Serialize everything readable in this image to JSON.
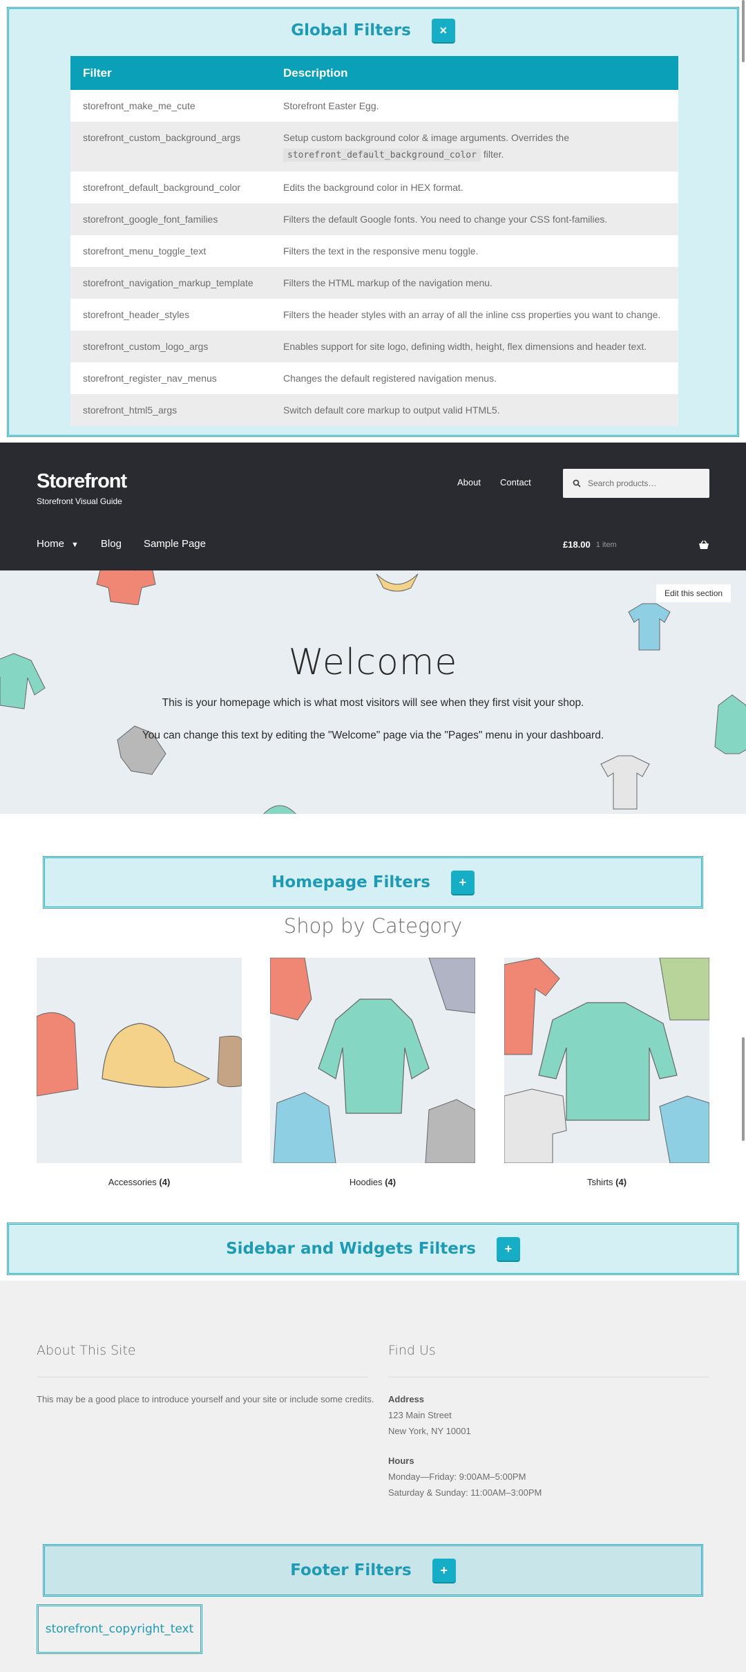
{
  "global_filters": {
    "title": "Global Filters",
    "toggle": "×",
    "headers": [
      "Filter",
      "Description"
    ],
    "rows": [
      {
        "name": "storefront_make_me_cute",
        "desc": "Storefront Easter Egg."
      },
      {
        "name": "storefront_custom_background_args",
        "desc": "Setup custom background color & image arguments. Overrides the",
        "code": "storefront_default_background_color",
        "desc_after": " filter."
      },
      {
        "name": "storefront_default_background_color",
        "desc": "Edits the background color in HEX format."
      },
      {
        "name": "storefront_google_font_families",
        "desc": "Filters the default Google fonts. You need to change your CSS font-families."
      },
      {
        "name": "storefront_menu_toggle_text",
        "desc": "Filters the text in the responsive menu toggle."
      },
      {
        "name": "storefront_navigation_markup_template",
        "desc": "Filters the HTML markup of the navigation menu."
      },
      {
        "name": "storefront_header_styles",
        "desc": "Filters the header styles with an array of all the inline css properties you want to change."
      },
      {
        "name": "storefront_custom_logo_args",
        "desc": "Enables support for site logo, defining width, height, flex dimensions and header text."
      },
      {
        "name": "storefront_register_nav_menus",
        "desc": "Changes the default registered navigation menus."
      },
      {
        "name": "storefront_html5_args",
        "desc": "Switch default core markup to output valid HTML5."
      }
    ]
  },
  "header": {
    "site_title": "Storefront",
    "site_description": "Storefront Visual Guide",
    "top_nav": [
      "About",
      "Contact"
    ],
    "search_placeholder": "Search products…",
    "main_nav": {
      "home": "Home",
      "blog": "Blog",
      "sample": "Sample Page"
    },
    "cart_amount": "£18.00",
    "cart_count": "1 item"
  },
  "hero": {
    "edit_label": "Edit this section",
    "title": "Welcome",
    "p1": "This is your homepage which is what most visitors will see when they first visit your shop.",
    "p2": "You can change this text by editing the \"Welcome\" page via the \"Pages\" menu in your dashboard."
  },
  "homepage_filters": {
    "title": "Homepage Filters",
    "toggle": "+"
  },
  "shop": {
    "title": "Shop by Category",
    "categories": [
      {
        "name": "Accessories",
        "count": "(4)"
      },
      {
        "name": "Hoodies",
        "count": "(4)"
      },
      {
        "name": "Tshirts",
        "count": "(4)"
      }
    ]
  },
  "sidebar_filters": {
    "title": "Sidebar and Widgets Filters",
    "toggle": "+"
  },
  "footer": {
    "about_title": "About This Site",
    "about_text": "This may be a good place to introduce yourself and your site or include some credits.",
    "find_title": "Find Us",
    "address_label": "Address",
    "address_line1": "123 Main Street",
    "address_line2": "New York, NY 10001",
    "hours_label": "Hours",
    "hours_line1": "Monday—Friday: 9:00AM–5:00PM",
    "hours_line2": "Saturday & Sunday: 11:00AM–3:00PM"
  },
  "footer_filters": {
    "title": "Footer Filters",
    "toggle": "+"
  },
  "copyright_filter": "storefront_copyright_text",
  "colors": {
    "accent": "#15aec6",
    "panel_bg": "#d4f0f4",
    "header_bg": "#2a2b31",
    "table_header": "#0aa0b8"
  }
}
